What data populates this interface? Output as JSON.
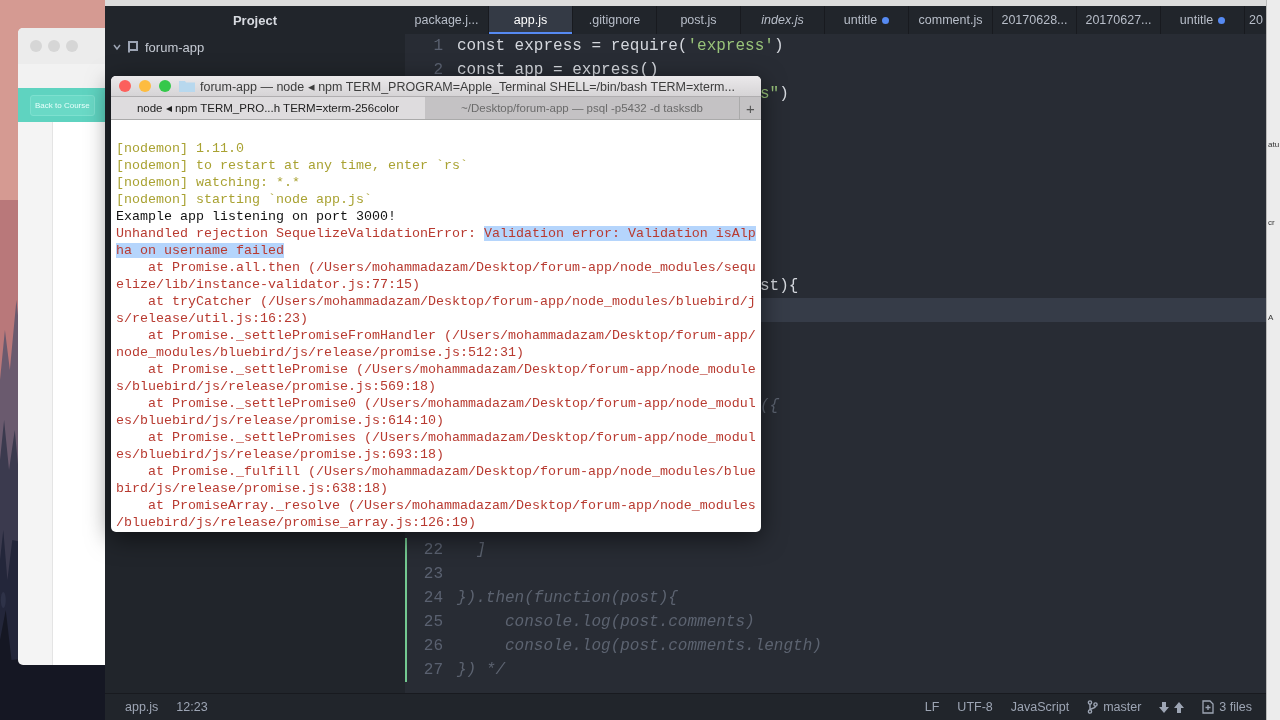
{
  "browser_window": {
    "button": "Back to Course"
  },
  "editor": {
    "sidebar": {
      "title": "Project",
      "tree": [
        {
          "label": "forum-app",
          "expanded": true
        }
      ]
    },
    "tabs": [
      {
        "label": "package.j...",
        "selected": false,
        "modified": false,
        "preview": false
      },
      {
        "label": "app.js",
        "selected": true,
        "modified": false,
        "preview": false
      },
      {
        "label": ".gitignore",
        "selected": false,
        "modified": false,
        "preview": false
      },
      {
        "label": "post.js",
        "selected": false,
        "modified": false,
        "preview": false
      },
      {
        "label": "index.js",
        "selected": false,
        "modified": false,
        "preview": true
      },
      {
        "label": "untitle",
        "selected": false,
        "modified": true,
        "preview": false
      },
      {
        "label": "comment.js",
        "selected": false,
        "modified": false,
        "preview": false
      },
      {
        "label": "20170628...",
        "selected": false,
        "modified": false,
        "preview": false
      },
      {
        "label": "20170627...",
        "selected": false,
        "modified": false,
        "preview": false
      },
      {
        "label": "untitle",
        "selected": false,
        "modified": true,
        "preview": false
      },
      {
        "label": "20",
        "selected": false,
        "modified": false,
        "preview": false
      }
    ],
    "lines": [
      {
        "kind": "full",
        "number": "1",
        "changed": false,
        "cursor": false,
        "segments": [
          {
            "kind": "keyword",
            "text": "const"
          },
          {
            "kind": "plain",
            "text": " express = require("
          },
          {
            "kind": "string",
            "text": "'express'"
          },
          {
            "kind": "plain",
            "text": ")"
          }
        ]
      },
      {
        "kind": "full",
        "number": "2",
        "changed": false,
        "cursor": false,
        "segments": [
          {
            "kind": "keyword",
            "text": "const"
          },
          {
            "kind": "plain",
            "text": " app = express()"
          }
        ]
      },
      {
        "kind": "tail",
        "cursor": false,
        "segments": [
          {
            "kind": "string",
            "text": "s\""
          },
          {
            "kind": "plain",
            "text": ")"
          }
        ]
      },
      {
        "kind": "blank"
      },
      {
        "kind": "blank"
      },
      {
        "kind": "blank"
      },
      {
        "kind": "blank"
      },
      {
        "kind": "blank"
      },
      {
        "kind": "blank"
      },
      {
        "kind": "blank"
      },
      {
        "kind": "tail",
        "cursor": false,
        "segments": [
          {
            "kind": "plain",
            "text": "st){"
          }
        ]
      },
      {
        "kind": "tail",
        "cursor": true
      },
      {
        "kind": "blank"
      },
      {
        "kind": "blank"
      },
      {
        "kind": "blank"
      },
      {
        "kind": "tail",
        "cursor": false,
        "segments": [
          {
            "kind": "comment",
            "text": "({"
          }
        ]
      },
      {
        "kind": "blank"
      },
      {
        "kind": "blank"
      },
      {
        "kind": "blank"
      },
      {
        "kind": "blank"
      },
      {
        "kind": "blank"
      },
      {
        "kind": "full",
        "number": "22",
        "changed": true,
        "cursor": false,
        "segments": [
          {
            "kind": "comment",
            "text": "  ]"
          }
        ]
      },
      {
        "kind": "full",
        "number": "23",
        "changed": true,
        "cursor": false
      },
      {
        "kind": "full",
        "number": "24",
        "changed": true,
        "cursor": false,
        "segments": [
          {
            "kind": "comment",
            "text": "}).then(function(post){"
          }
        ]
      },
      {
        "kind": "full",
        "number": "25",
        "changed": true,
        "cursor": false,
        "segments": [
          {
            "kind": "comment",
            "text": "     console.log(post.comments)"
          }
        ]
      },
      {
        "kind": "full",
        "number": "26",
        "changed": true,
        "cursor": false,
        "segments": [
          {
            "kind": "comment",
            "text": "     console.log(post.comments.length)"
          }
        ]
      },
      {
        "kind": "full",
        "number": "27",
        "changed": true,
        "cursor": false,
        "segments": [
          {
            "kind": "comment",
            "text": "}) */"
          }
        ]
      }
    ],
    "status_bar": {
      "file": "app.js",
      "cursor": "12:23",
      "line_ending": "LF",
      "encoding": "UTF-8",
      "grammar": "JavaScript",
      "branch": "master",
      "files": "3 files"
    }
  },
  "side_panel": {
    "fragments": [
      "atu",
      "cr",
      "A"
    ]
  },
  "terminal": {
    "title": "forum-app — node ◂ npm TERM_PROGRAM=Apple_Terminal SHELL=/bin/bash TERM=xterm...",
    "tabs": [
      {
        "label": "node ◂ npm TERM_PRO...h TERM=xterm-256color",
        "selected": true
      },
      {
        "label": "~/Desktop/forum-app — psql -p5432 -d tasksdb",
        "selected": false
      }
    ],
    "new_tab": "+",
    "lines": [
      {
        "kind": "nodemon",
        "segments": [
          {
            "text": "[nodemon] 1.11.0",
            "selected": false
          }
        ]
      },
      {
        "kind": "nodemon",
        "segments": [
          {
            "text": "[nodemon] to restart at any time, enter `rs`",
            "selected": false
          }
        ]
      },
      {
        "kind": "nodemon",
        "segments": [
          {
            "text": "[nodemon] watching: *.*",
            "selected": false
          }
        ]
      },
      {
        "kind": "nodemon",
        "segments": [
          {
            "text": "[nodemon] starting `node app.js`",
            "selected": false
          }
        ]
      },
      {
        "kind": "log",
        "segments": [
          {
            "text": "Example app listening on port 3000!",
            "selected": false
          }
        ]
      },
      {
        "kind": "error",
        "segments": [
          {
            "text": "Unhandled rejection SequelizeValidationError: ",
            "selected": false
          },
          {
            "text": "Validation error: Validation isAlp",
            "selected": true
          }
        ]
      },
      {
        "kind": "error",
        "segments": [
          {
            "text": "ha on username failed",
            "selected": true
          }
        ]
      },
      {
        "kind": "error",
        "segments": [
          {
            "text": "    at Promise.all.then (/Users/mohammadazam/Desktop/forum-app/node_modules/sequ",
            "selected": false
          }
        ]
      },
      {
        "kind": "error",
        "segments": [
          {
            "text": "elize/lib/instance-validator.js:77:15)",
            "selected": false
          }
        ]
      },
      {
        "kind": "error",
        "segments": [
          {
            "text": "    at tryCatcher (/Users/mohammadazam/Desktop/forum-app/node_modules/bluebird/j",
            "selected": false
          }
        ]
      },
      {
        "kind": "error",
        "segments": [
          {
            "text": "s/release/util.js:16:23)",
            "selected": false
          }
        ]
      },
      {
        "kind": "error",
        "segments": [
          {
            "text": "    at Promise._settlePromiseFromHandler (/Users/mohammadazam/Desktop/forum-app/",
            "selected": false
          }
        ]
      },
      {
        "kind": "error",
        "segments": [
          {
            "text": "node_modules/bluebird/js/release/promise.js:512:31)",
            "selected": false
          }
        ]
      },
      {
        "kind": "error",
        "segments": [
          {
            "text": "    at Promise._settlePromise (/Users/mohammadazam/Desktop/forum-app/node_module",
            "selected": false
          }
        ]
      },
      {
        "kind": "error",
        "segments": [
          {
            "text": "s/bluebird/js/release/promise.js:569:18)",
            "selected": false
          }
        ]
      },
      {
        "kind": "error",
        "segments": [
          {
            "text": "    at Promise._settlePromise0 (/Users/mohammadazam/Desktop/forum-app/node_modul",
            "selected": false
          }
        ]
      },
      {
        "kind": "error",
        "segments": [
          {
            "text": "es/bluebird/js/release/promise.js:614:10)",
            "selected": false
          }
        ]
      },
      {
        "kind": "error",
        "segments": [
          {
            "text": "    at Promise._settlePromises (/Users/mohammadazam/Desktop/forum-app/node_modul",
            "selected": false
          }
        ]
      },
      {
        "kind": "error",
        "segments": [
          {
            "text": "es/bluebird/js/release/promise.js:693:18)",
            "selected": false
          }
        ]
      },
      {
        "kind": "error",
        "segments": [
          {
            "text": "    at Promise._fulfill (/Users/mohammadazam/Desktop/forum-app/node_modules/blue",
            "selected": false
          }
        ]
      },
      {
        "kind": "error",
        "segments": [
          {
            "text": "bird/js/release/promise.js:638:18)",
            "selected": false
          }
        ]
      },
      {
        "kind": "error",
        "segments": [
          {
            "text": "    at PromiseArray._resolve (/Users/mohammadazam/Desktop/forum-app/node_modules",
            "selected": false
          }
        ]
      },
      {
        "kind": "error",
        "segments": [
          {
            "text": "/bluebird/js/release/promise_array.js:126:19)",
            "selected": false
          }
        ]
      }
    ]
  }
}
